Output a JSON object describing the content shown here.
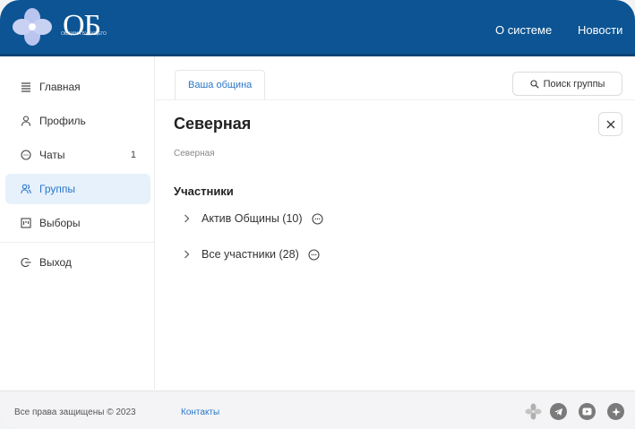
{
  "header": {
    "logo_text": "ОБ",
    "logo_subtitle": "ОБЩИНА БУДУЩЕГО",
    "nav": [
      "О системе",
      "Новости"
    ]
  },
  "sidebar": {
    "items": [
      {
        "label": "Главная",
        "icon": "home-list-icon"
      },
      {
        "label": "Профиль",
        "icon": "user-icon"
      },
      {
        "label": "Чаты",
        "icon": "chat-icon",
        "badge": "1"
      },
      {
        "label": "Группы",
        "icon": "group-icon",
        "active": true
      },
      {
        "label": "Выборы",
        "icon": "ballot-icon"
      },
      {
        "label": "Выход",
        "icon": "logout-icon"
      }
    ]
  },
  "main": {
    "tab_label": "Ваша община",
    "search_label": "Поиск группы",
    "title": "Северная",
    "subtitle": "Северная",
    "section_title": "Участники",
    "groups": [
      {
        "label": "Актив Общины (10)"
      },
      {
        "label": "Все участники (28)"
      }
    ]
  },
  "footer": {
    "copyright": "Все права защищены © 2023",
    "contacts": "Контакты",
    "social": [
      "logo-flower-icon",
      "telegram-icon",
      "youtube-icon",
      "vk-icon"
    ]
  },
  "colors": {
    "header_bg": "#0c5493",
    "accent": "#2a77c9",
    "active_bg": "#e6f1fc",
    "social_gray": "#7a7a7a"
  }
}
